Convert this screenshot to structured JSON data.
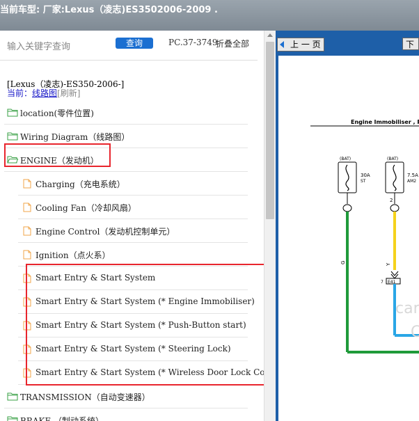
{
  "header": {
    "title": "当前车型:  厂家:Lexus（凌志)ES3502006-2009   ."
  },
  "search": {
    "placeholder": "输入关键字查询",
    "button": "查询",
    "pc": "PC.37-3749",
    "fold_all": "折叠全部"
  },
  "crumb": "[Lexus（凌志)-ES350-2006-]",
  "current": {
    "prefix": "当前：",
    "name": "线路图",
    "refresh": "[刷新]"
  },
  "tree": [
    {
      "label": "location(零件位置)",
      "type": "folder"
    },
    {
      "label": "Wiring Diagram（线路图）",
      "type": "folder"
    },
    {
      "label": "ENGINE（发动机）",
      "type": "folder-open"
    },
    {
      "label": "Charging（充电系统）",
      "type": "doc"
    },
    {
      "label": "Cooling Fan（冷却风扇）",
      "type": "doc"
    },
    {
      "label": "Engine Control（发动机控制单元）",
      "type": "doc"
    },
    {
      "label": "Ignition（点火系）",
      "type": "doc"
    },
    {
      "label": "Smart Entry & Start System",
      "type": "doc"
    },
    {
      "label": "Smart Entry & Start System (* Engine Immobiliser)",
      "type": "doc"
    },
    {
      "label": "Smart Entry & Start System (* Push-Button start)",
      "type": "doc"
    },
    {
      "label": "Smart Entry & Start System (* Steering Lock)",
      "type": "doc"
    },
    {
      "label": "Smart Entry & Start System (* Wireless Door Lock Control)",
      "type": "doc"
    },
    {
      "label": "TRANSMISSION（自动变速器）",
      "type": "folder"
    },
    {
      "label": "BRAKE （制动系统）",
      "type": "folder"
    }
  ],
  "viewer": {
    "prev": "上 一 页",
    "next": "下",
    "diagram_title": "Engine Immobiliser , Pus",
    "bat1": "(BAT)",
    "bat2": "(BAT)",
    "fuse1a": "30A",
    "fuse1b": "ST",
    "fuse2a": "7.5A",
    "fuse2b": "AM2",
    "pin2": "2",
    "wire_g": "G",
    "wire_y": "Y",
    "e41": "7",
    "e41b": "E41",
    "watermark": "car",
    "watermark2": "C"
  },
  "colors": {
    "accent": "#1b6fd1",
    "highlight": "#e8252d",
    "viewer_bg": "#1e5fa8"
  }
}
